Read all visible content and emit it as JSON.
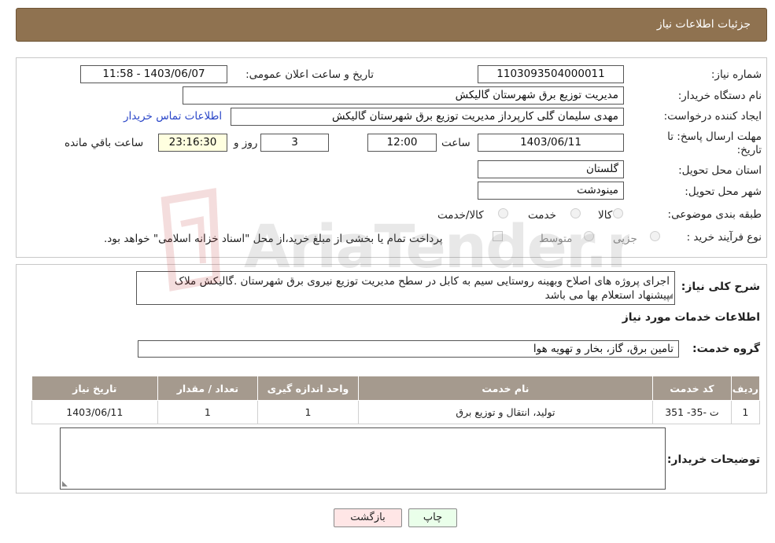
{
  "header": {
    "title": "جزئیات اطلاعات نیاز"
  },
  "form": {
    "need_number_label": "شماره نیاز:",
    "need_number": "1103093504000011",
    "announce_label": "تاریخ و ساعت اعلان عمومی:",
    "announce_value": "1403/06/07 - 11:58",
    "buyer_org_label": "نام دستگاه خریدار:",
    "buyer_org": "مدیریت توزیع برق شهرستان گالیکش",
    "requester_label": "ایجاد کننده درخواست:",
    "requester": "مهدی سلیمان گلی کارپرداز مدیریت توزیع برق شهرستان گالیکش",
    "contact_link": "اطلاعات تماس خریدار",
    "deadline_label_1": "مهلت ارسال پاسخ: تا",
    "deadline_label_2": "تاریخ:",
    "deadline_date": "1403/06/11",
    "time_label": "ساعت",
    "deadline_time": "12:00",
    "days_value": "3",
    "days_label": "روز و",
    "remaining_time": "23:16:30",
    "remaining_label": "ساعت باقي مانده",
    "province_label": "استان محل تحویل:",
    "province": "گلستان",
    "city_label": "شهر محل تحویل:",
    "city": "مینودشت",
    "category_label": "طبقه بندی موضوعی:",
    "category_options": [
      "کالا",
      "خدمت",
      "کالا/خدمت"
    ],
    "process_label": "نوع فرآیند خرید :",
    "process_options": [
      "جزیی",
      "متوسط"
    ],
    "payment_note": "پرداخت تمام یا بخشی از مبلغ خرید،از محل \"اسناد خزانه اسلامی\" خواهد بود."
  },
  "details": {
    "desc_label": "شرح کلی نیاز:",
    "desc_text": "اجرای پروژه های اصلاح وبهینه روستایی سیم به کابل در سطح مدیریت توزیع نیروی برق شهرستان .گالیکش ملاک پیشنهاد استعلام بها می باشد",
    "services_title": "اطلاعات خدمات مورد نیاز",
    "group_label": "گروه خدمت:",
    "group_value": "تامین برق، گاز، بخار و تهویه هوا",
    "table": {
      "headers": [
        "ردیف",
        "کد خدمت",
        "نام خدمت",
        "واحد اندازه گیری",
        "تعداد / مقدار",
        "تاریخ نیاز"
      ],
      "rows": [
        [
          "1",
          "ت -35- 351",
          "تولید، انتقال و توزیع برق",
          "1",
          "1",
          "1403/06/11"
        ]
      ]
    },
    "buyer_notes_label": "توضیحات خریدار:",
    "buyer_notes": ""
  },
  "buttons": {
    "print": "چاپ",
    "back": "بازگشت"
  },
  "colors": {
    "header_bg": "#8f7250",
    "table_header_bg": "#a59a8e",
    "link": "#2a46c8",
    "back_button_bg": "#ffe6e6",
    "print_button_bg": "#eaffea"
  }
}
